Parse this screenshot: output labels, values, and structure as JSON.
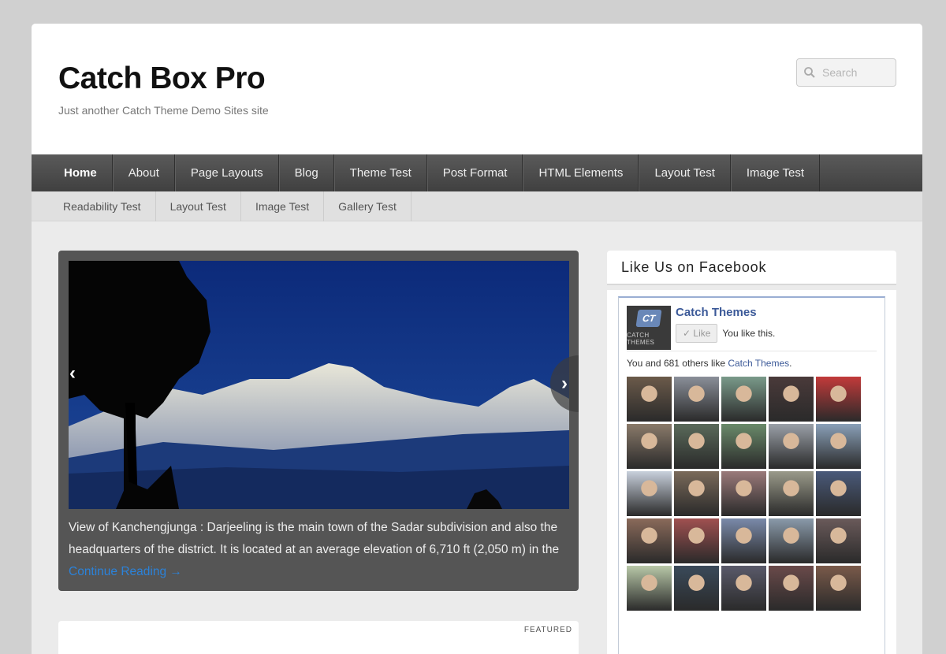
{
  "site": {
    "title": "Catch Box Pro",
    "description": "Just another Catch Theme Demo Sites site"
  },
  "search": {
    "placeholder": "Search"
  },
  "nav_primary": [
    {
      "label": "Home",
      "active": true
    },
    {
      "label": "About"
    },
    {
      "label": "Page Layouts"
    },
    {
      "label": "Blog"
    },
    {
      "label": "Theme Test"
    },
    {
      "label": "Post Format"
    },
    {
      "label": "HTML Elements"
    },
    {
      "label": "Layout Test"
    },
    {
      "label": "Image Test"
    }
  ],
  "nav_secondary": [
    {
      "label": "Readability Test"
    },
    {
      "label": "Layout Test"
    },
    {
      "label": "Image Test"
    },
    {
      "label": "Gallery Test"
    }
  ],
  "slider": {
    "prev_icon": "‹",
    "next_icon": "›",
    "caption": "View of Kanchengjunga : Darjeeling is the main town of the Sadar subdivision and also the headquarters of the district. It is located at an average elevation of 6,710 ft (2,050 m) in the ",
    "continue_link": "Continue Reading →"
  },
  "post": {
    "badge": "FEATURED"
  },
  "facebook_widget": {
    "title": "Like Us on Facebook",
    "page_name": "Catch Themes",
    "logo_badge": "CT",
    "logo_text": "CATCH THEMES",
    "like_button": "✓ Like",
    "you_like": "You like this.",
    "count_prefix": "You and 681 others like ",
    "count_link": "Catch Themes",
    "count_suffix": ".",
    "face_colors": [
      "#6b5a4a",
      "#8a8f99",
      "#7a9a8a",
      "#4a3a3a",
      "#c23a3a",
      "#8a7a6a",
      "#5a6a5a",
      "#6a8a6a",
      "#9aa0a8",
      "#8aa0b8",
      "#c8d0dc",
      "#7a6a5a",
      "#9a7a7a",
      "#9a9a8a",
      "#4a5a7a",
      "#8a6a5a",
      "#a05050",
      "#7a8aaa",
      "#8a9aaa",
      "#6a5a5a",
      "#b8c8a8",
      "#3a4a5a",
      "#5a5a6a",
      "#6a4a4a",
      "#7a5a4a"
    ]
  }
}
